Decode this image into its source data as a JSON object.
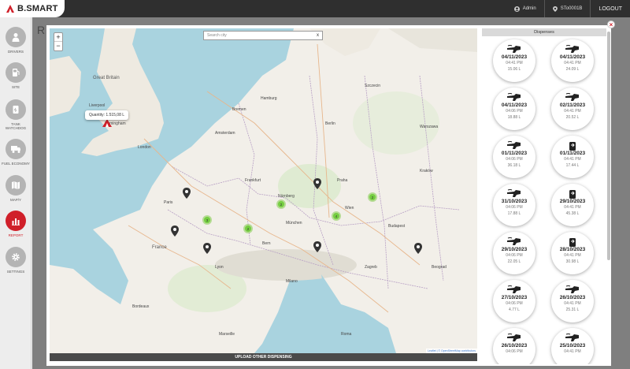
{
  "app": {
    "logo": "B.SMART",
    "brand_color": "#d0202a"
  },
  "topbar": {
    "user": "Admin",
    "site": "STo0001B",
    "logout": "LOGOUT"
  },
  "sidebar": {
    "items": [
      {
        "label": "DRIVERS",
        "icon": "person-icon",
        "active": false
      },
      {
        "label": "SITE",
        "icon": "fuel-station-icon",
        "active": false
      },
      {
        "label": "TANK WATCHDOG",
        "icon": "tank-icon",
        "active": false
      },
      {
        "label": "FUEL ECONOMY",
        "icon": "truck-icon",
        "active": false
      },
      {
        "label": "MAP/Y",
        "icon": "map-icon",
        "active": false
      },
      {
        "label": "REPORT",
        "icon": "chart-icon",
        "active": true
      },
      {
        "label": "SETTINGS",
        "icon": "gear-icon",
        "active": false
      }
    ]
  },
  "background": {
    "title": "R"
  },
  "map": {
    "search_placeholder": "Search city",
    "zoom_in": "+",
    "zoom_out": "−",
    "tooltip_text": "Quantity: 1.515,08 L",
    "tooltip_unit": "L",
    "attribution": "Leaflet | © OpenStreetMap contributors",
    "clusters": [
      "3",
      "2",
      "2",
      "2",
      "4"
    ],
    "labels": [
      "Great Britain",
      "Liverpool",
      "Birmingham",
      "London",
      "Amsterdam",
      "Hamburg",
      "Berlin",
      "Warszawa",
      "Praha",
      "Paris",
      "France",
      "Lyon",
      "Bern",
      "München",
      "Wien",
      "Budapest",
      "Milano",
      "Roma",
      "Beograd",
      "Kraków",
      "Frankfurt",
      "Nürnberg",
      "Szczecin",
      "Bremen",
      "Bordeaux",
      "Zagreb",
      "Marseille"
    ]
  },
  "actions": {
    "upload": "UPLOAD OTHER DISPENSING"
  },
  "dispenses": {
    "title": "Dispenses",
    "items": [
      {
        "date": "04/11/2023",
        "time": "04:41 PM",
        "qty": "15.06 L",
        "icon": "nozzle-icon"
      },
      {
        "date": "04/11/2023",
        "time": "04:41 PM",
        "qty": "24.09 L",
        "icon": "nozzle-icon"
      },
      {
        "date": "04/11/2023",
        "time": "04:06 PM",
        "qty": "18.88 L",
        "icon": "nozzle-icon"
      },
      {
        "date": "02/11/2023",
        "time": "04:41 PM",
        "qty": "20.52 L",
        "icon": "nozzle-icon"
      },
      {
        "date": "01/11/2023",
        "time": "04:06 PM",
        "qty": "36.18 L",
        "icon": "nozzle-icon"
      },
      {
        "date": "01/11/2023",
        "time": "04:41 PM",
        "qty": "17.44 L",
        "icon": "tank-refill-icon"
      },
      {
        "date": "31/10/2023",
        "time": "04:06 PM",
        "qty": "17.88 L",
        "icon": "nozzle-icon"
      },
      {
        "date": "29/10/2023",
        "time": "04:41 PM",
        "qty": "45.38 L",
        "icon": "tank-refill-icon"
      },
      {
        "date": "29/10/2023",
        "time": "04:06 PM",
        "qty": "22.05 L",
        "icon": "nozzle-icon"
      },
      {
        "date": "28/10/2023",
        "time": "04:41 PM",
        "qty": "30.98 L",
        "icon": "tank-refill-icon"
      },
      {
        "date": "27/10/2023",
        "time": "04:06 PM",
        "qty": "4.77 L",
        "icon": "nozzle-icon"
      },
      {
        "date": "26/10/2023",
        "time": "04:41 PM",
        "qty": "25.31 L",
        "icon": "nozzle-icon"
      },
      {
        "date": "26/10/2023",
        "time": "04:06 PM",
        "qty": "",
        "icon": "nozzle-icon"
      },
      {
        "date": "25/10/2023",
        "time": "04:41 PM",
        "qty": "",
        "icon": "nozzle-icon"
      }
    ]
  },
  "modal": {
    "close": "×"
  }
}
